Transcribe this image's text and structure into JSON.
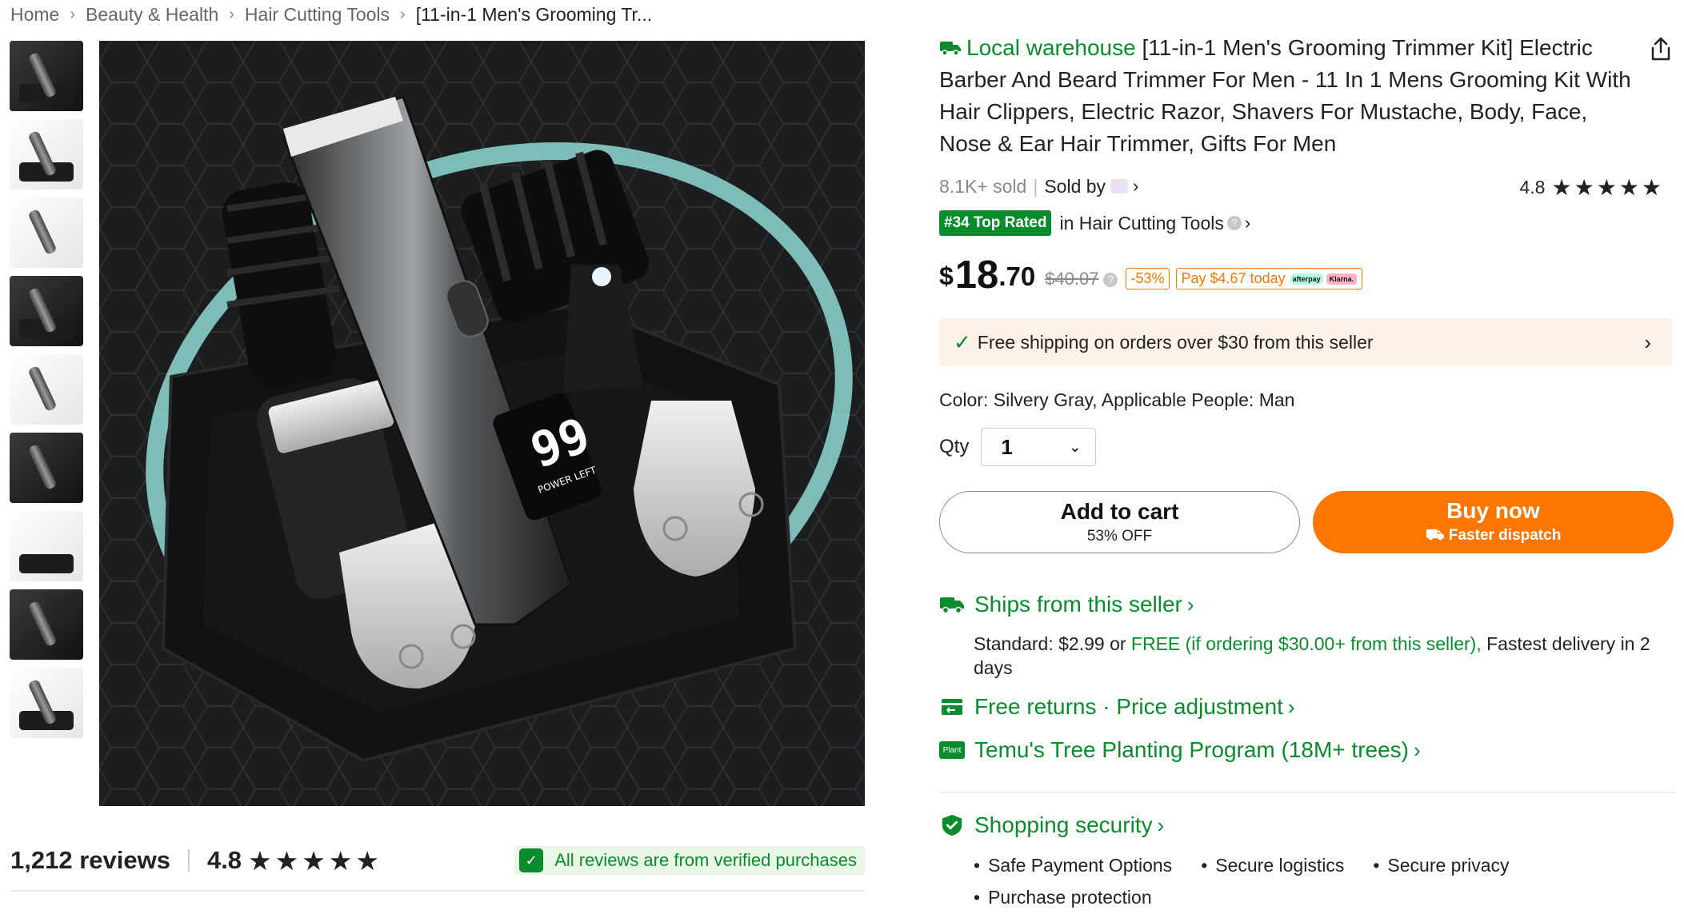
{
  "breadcrumb": {
    "items": [
      "Home",
      "Beauty & Health",
      "Hair Cutting Tools",
      "[11-in-1 Men's Grooming Tr..."
    ],
    "separator": "›"
  },
  "gallery": {
    "thumbnail_count": 9,
    "main_image_alt": "Men's grooming trimmer kit on black charging stand",
    "display_text": "99",
    "display_subtext": "POWER LEFT"
  },
  "reviews": {
    "count_label": "1,212 reviews",
    "rating": "4.8",
    "stars": "★★★★★",
    "verified_text": "All reviews are from verified purchases"
  },
  "product": {
    "local_label": "Local warehouse",
    "title": " [11-in-1 Men's Grooming Trimmer Kit] Electric Barber And Beard Trimmer For Men - 11 In 1 Mens Grooming Kit With Hair Clippers, Electric Razor, Shavers For Mustache, Body, Face, Nose & Ear Hair Trimmer, Gifts For Men",
    "sold": "8.1K+ sold",
    "sold_by": "Sold by",
    "rating": "4.8",
    "stars": "★★★★★",
    "rank_badge": "#34 Top Rated",
    "rank_category": "in Hair Cutting Tools"
  },
  "price": {
    "currency": "$",
    "integer": "18",
    "decimal": ".70",
    "original": "$40.07",
    "discount": "-53%",
    "pay_today": "Pay $4.67 today",
    "afterpay": "afterpay",
    "klarna": "Klarna."
  },
  "shipping_banner": {
    "text": "Free shipping on orders over $30 from this seller"
  },
  "specs": {
    "text": "Color: Silvery Gray, Applicable People: Man"
  },
  "quantity": {
    "label": "Qty",
    "value": "1"
  },
  "buttons": {
    "add_to_cart": "Add to cart",
    "add_to_cart_sub": "53% OFF",
    "buy_now": "Buy now",
    "buy_now_sub": "Faster dispatch"
  },
  "shipping_info": {
    "title": "Ships from this seller",
    "standard_prefix": "Standard: $2.99 or ",
    "free_text": "FREE (if ordering $30.00+ from this seller),",
    "fastest": " Fastest delivery in 2 days"
  },
  "returns": {
    "text": "Free returns · Price adjustment"
  },
  "tree_program": {
    "icon_text": "Plant",
    "text": "Temu's Tree Planting Program (18M+ trees)"
  },
  "security": {
    "title": "Shopping security",
    "items": [
      "Safe Payment Options",
      "Secure logistics",
      "Secure privacy",
      "Purchase protection"
    ]
  },
  "colors": {
    "accent_green": "#0a8c2c",
    "accent_orange": "#fb7701",
    "banner_bg": "#fef1e7"
  }
}
